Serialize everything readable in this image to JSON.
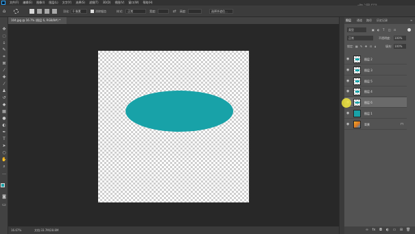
{
  "menu": [
    "文件(F)",
    "编辑(E)",
    "图像(I)",
    "图层(L)",
    "文字(Y)",
    "选择(S)",
    "滤镜(T)",
    "3D(D)",
    "视图(V)",
    "窗口(W)",
    "帮助(H)"
  ],
  "options": {
    "feather_label": "羽化:",
    "feather_value": "0 像素",
    "antialias_label": "消除锯齿",
    "style_label": "样式:",
    "style_value": "正常",
    "width_label": "宽度:",
    "height_label": "高度:",
    "select_mask_button": "选择并遮住..."
  },
  "document_tab": "104.jpg @ 16.7% (图层 6, RGB/8#) *",
  "status": {
    "zoom": "16.67%",
    "doc_info": "文档:33.7M/28.8M"
  },
  "panel": {
    "tabs": [
      "图层",
      "通道",
      "路径",
      "历史记录"
    ],
    "filter_label": "类型",
    "blend_mode": "正常",
    "opacity_label": "不透明度:",
    "opacity_value": "100%",
    "lock_label": "锁定:",
    "fill_label": "填充:",
    "fill_value": "100%"
  },
  "layers": [
    {
      "name": "图层 2",
      "thumb": "rect",
      "selected": false
    },
    {
      "name": "图层 3",
      "thumb": "rect",
      "selected": false
    },
    {
      "name": "图层 5",
      "thumb": "rect",
      "selected": false
    },
    {
      "name": "图层 4",
      "thumb": "rect",
      "selected": false
    },
    {
      "name": "图层 6",
      "thumb": "oval",
      "selected": true
    },
    {
      "name": "图层 1",
      "thumb": "fill",
      "selected": false
    },
    {
      "name": "背景",
      "thumb": "image",
      "selected": false
    }
  ],
  "colors": {
    "accent": "#18a2a8",
    "workspace": "#282828",
    "panel": "#535353"
  },
  "watermark": "虎课网"
}
